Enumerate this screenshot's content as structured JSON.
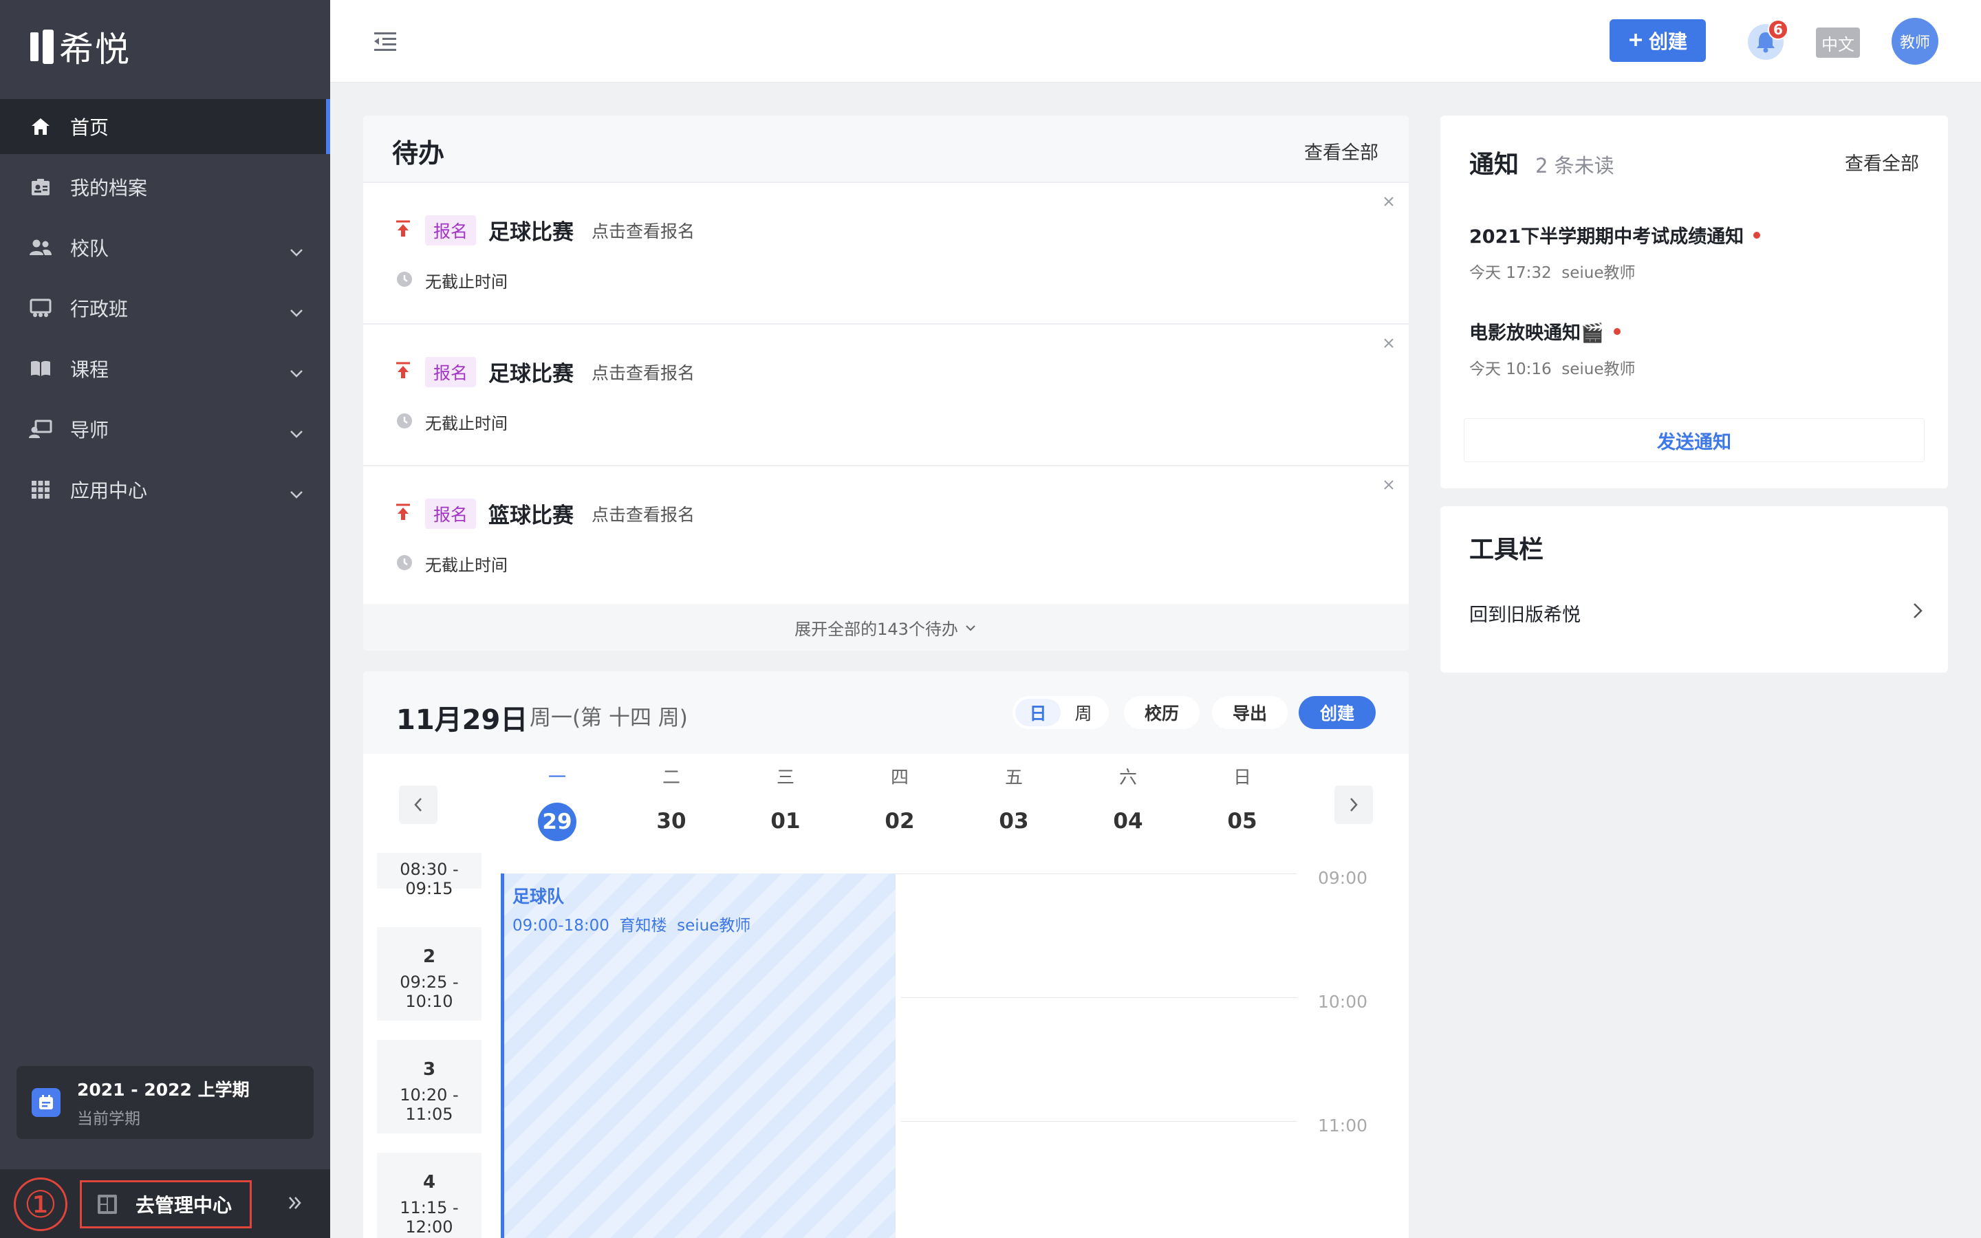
{
  "app": {
    "logo_text": "希悦"
  },
  "sidebar": {
    "items": [
      {
        "label": "首页",
        "active": true,
        "icon": "home-icon"
      },
      {
        "label": "我的档案",
        "icon": "profile-icon"
      },
      {
        "label": "校队",
        "icon": "team-icon",
        "expandable": true
      },
      {
        "label": "行政班",
        "icon": "class-icon",
        "expandable": true
      },
      {
        "label": "课程",
        "icon": "book-icon",
        "expandable": true
      },
      {
        "label": "导师",
        "icon": "mentor-icon",
        "expandable": true
      },
      {
        "label": "应用中心",
        "icon": "apps-icon",
        "expandable": true
      }
    ],
    "term": {
      "title": "2021 - 2022 上学期",
      "subtitle": "当前学期"
    },
    "admin": {
      "annotation": "①",
      "label": "去管理中心"
    }
  },
  "topbar": {
    "create_label": "创建",
    "notification_count": "6",
    "language": "中文",
    "avatar_label": "教师"
  },
  "todo": {
    "title": "待办",
    "view_all": "查看全部",
    "items": [
      {
        "tag": "报名",
        "title": "足球比赛",
        "desc": "点击查看报名",
        "deadline": "无截止时间"
      },
      {
        "tag": "报名",
        "title": "足球比赛",
        "desc": "点击查看报名",
        "deadline": "无截止时间"
      },
      {
        "tag": "报名",
        "title": "篮球比赛",
        "desc": "点击查看报名",
        "deadline": "无截止时间"
      }
    ],
    "expand_label": "展开全部的143个待办"
  },
  "notices": {
    "title": "通知",
    "unread": "2 条未读",
    "view_all": "查看全部",
    "items": [
      {
        "title": "2021下半学期期中考试成绩通知",
        "time": "今天 17:32",
        "author": "seiue教师"
      },
      {
        "title": "电影放映通知🎬",
        "time": "今天 10:16",
        "author": "seiue教师"
      }
    ],
    "send_label": "发送通知"
  },
  "toolbar_card": {
    "title": "工具栏",
    "item": "回到旧版希悦"
  },
  "calendar": {
    "date": "11月29日",
    "week_info": "周一(第 十四 周)",
    "view_day": "日",
    "view_week": "周",
    "school_calendar": "校历",
    "export": "导出",
    "create": "创建",
    "days": [
      {
        "name": "一",
        "num": "29",
        "today": true
      },
      {
        "name": "二",
        "num": "30"
      },
      {
        "name": "三",
        "num": "01"
      },
      {
        "name": "四",
        "num": "02"
      },
      {
        "name": "五",
        "num": "03"
      },
      {
        "name": "六",
        "num": "04"
      },
      {
        "name": "日",
        "num": "05"
      }
    ],
    "periods": [
      {
        "num": "",
        "time": "08:30 - 09:15"
      },
      {
        "num": "2",
        "time": "09:25 - 10:10"
      },
      {
        "num": "3",
        "time": "10:20 - 11:05"
      },
      {
        "num": "4",
        "time": "11:15 - 12:00"
      }
    ],
    "hours": [
      "09:00",
      "10:00",
      "11:00"
    ],
    "event": {
      "title": "足球队",
      "time": "09:00-18:00",
      "location": "育知楼",
      "teacher": "seiue教师"
    }
  },
  "colors": {
    "accent": "#3e78e6",
    "sidebar_bg": "#3a3d48",
    "alert_red": "#e0453b",
    "tag_purple": "#a137c2"
  }
}
